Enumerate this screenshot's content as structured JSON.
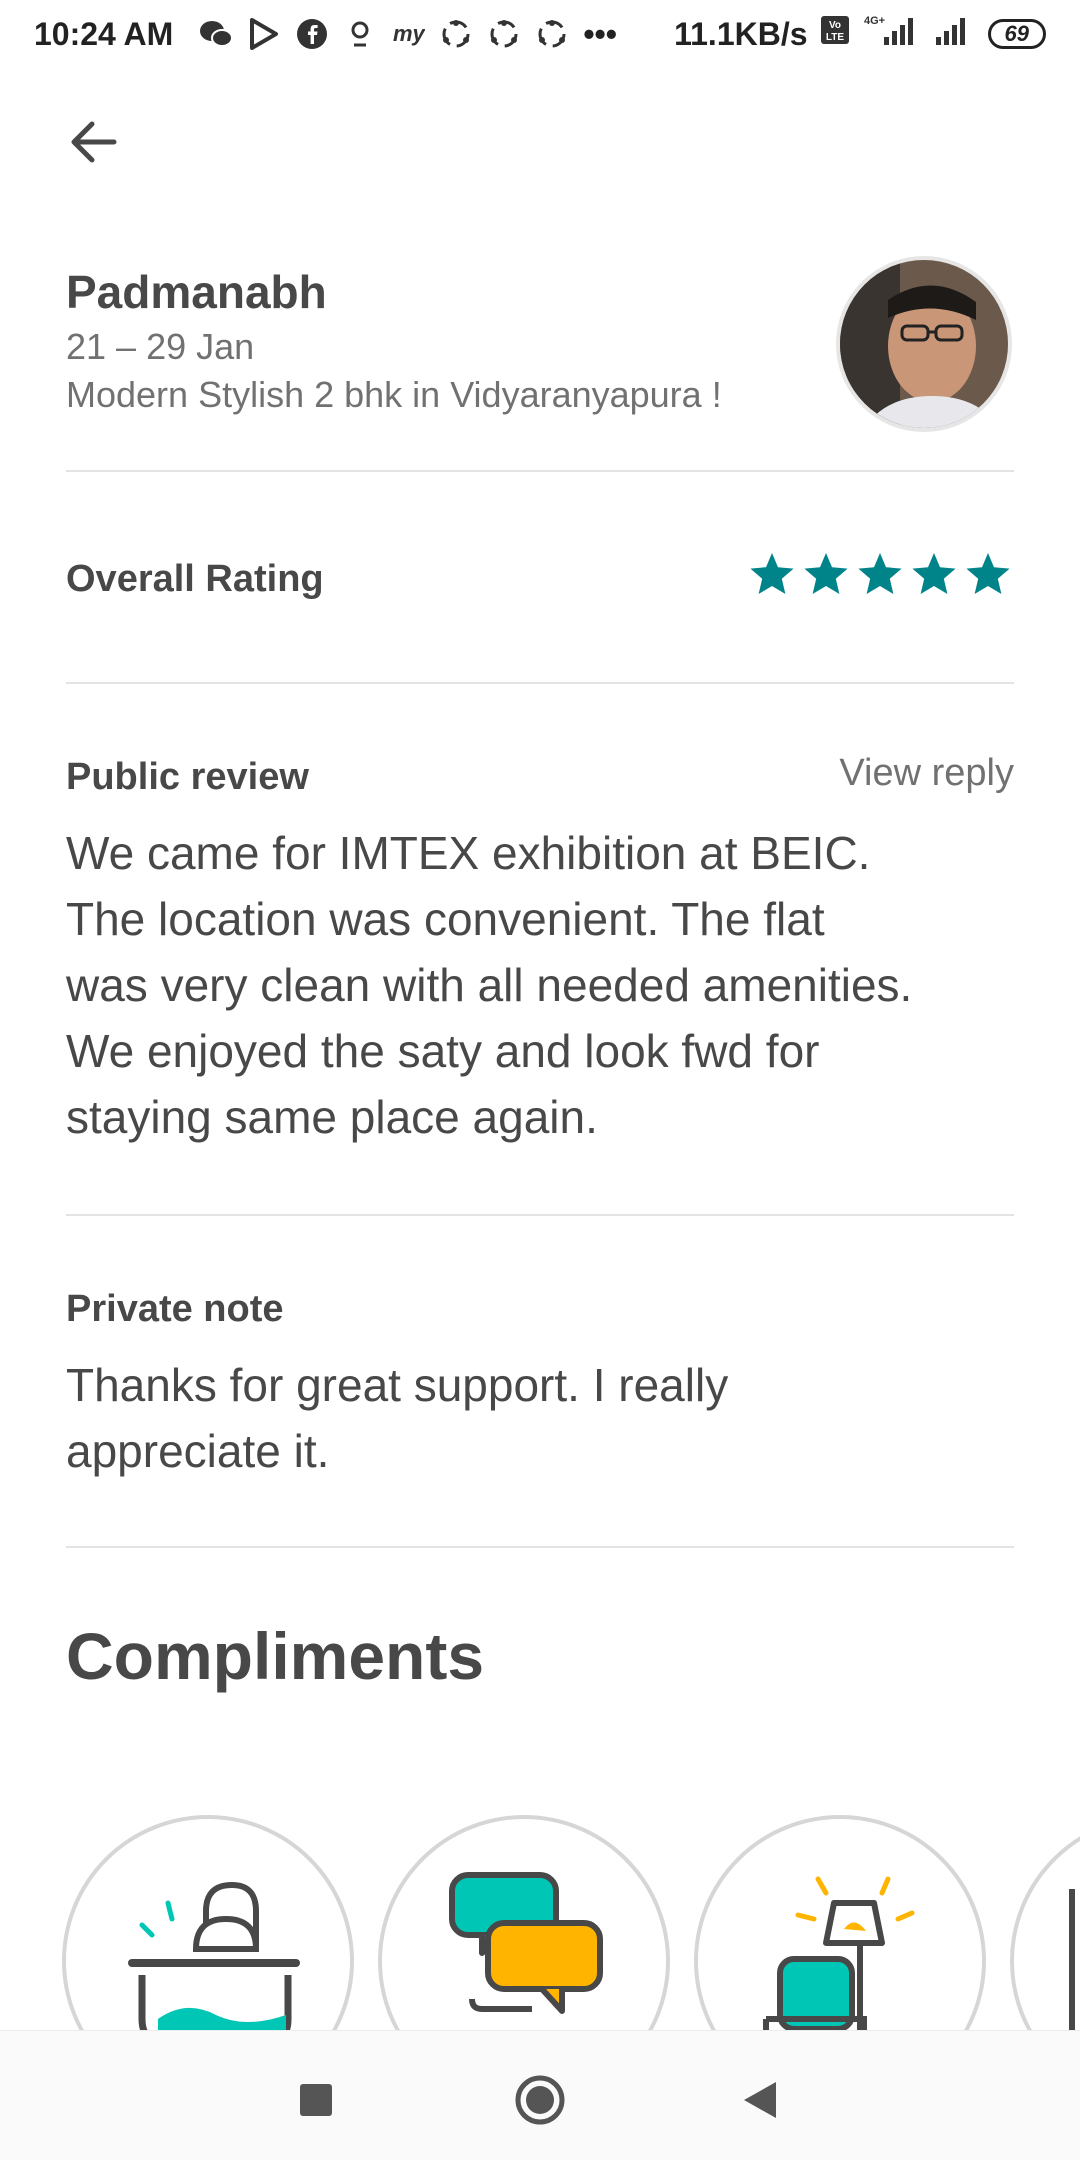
{
  "status_bar": {
    "time": "10:24 AM",
    "network_speed": "11.1KB/s",
    "network_type": "4G+",
    "battery": "69",
    "ellipsis": "•••"
  },
  "header": {
    "host_name": "Padmanabh",
    "dates": "21 – 29 Jan",
    "listing_title": "Modern Stylish 2 bhk in Vidyaranyapura !"
  },
  "rating": {
    "label": "Overall Rating",
    "value": 5,
    "max": 5,
    "star_color": "#008489"
  },
  "public_review": {
    "label": "Public review",
    "view_reply": "View reply",
    "lines": [
      "We came for IMTEX exhibition at BEIC.",
      "The location was convenient. The flat",
      "was very clean with all needed amenities.",
      "We enjoyed the saty and look fwd for",
      "staying same place again."
    ]
  },
  "private_note": {
    "label": "Private note",
    "lines": [
      "Thanks for great support. I really",
      "appreciate it."
    ]
  },
  "compliments": {
    "title": "Compliments",
    "badges": [
      {
        "icon": "bathtub-icon"
      },
      {
        "icon": "chat-bubbles-icon"
      },
      {
        "icon": "armchair-lamp-icon"
      },
      {
        "icon": "partial-badge-icon"
      }
    ]
  },
  "colors": {
    "accent_teal": "#00a699",
    "accent_orange": "#ffb400",
    "text_primary": "#484848",
    "text_secondary": "#717171"
  }
}
